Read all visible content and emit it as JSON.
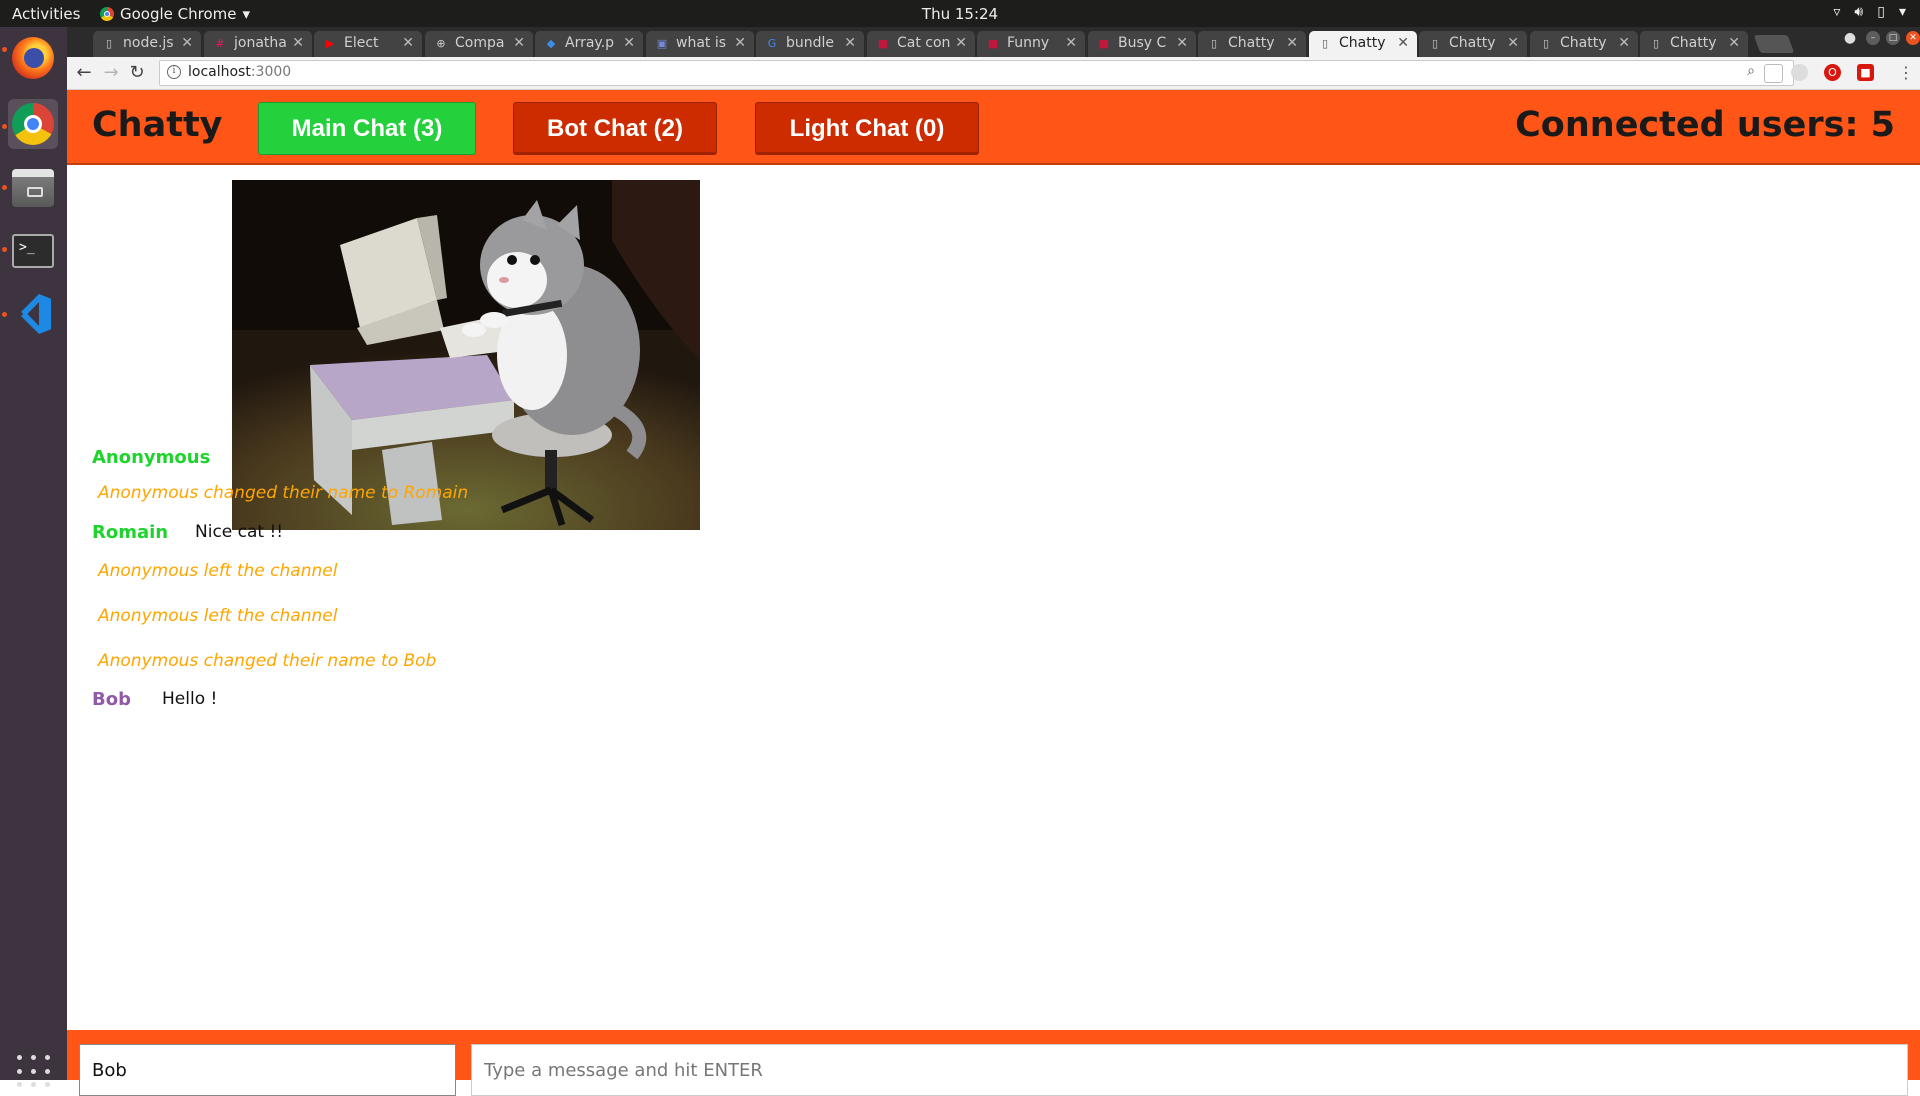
{
  "os": {
    "activities": "Activities",
    "app_menu": "Google Chrome",
    "clock": "Thu 15:24"
  },
  "browser": {
    "tabs": [
      {
        "title": "node.js",
        "favicon": "page-icon"
      },
      {
        "title": "jonatha",
        "favicon": "slack-icon"
      },
      {
        "title": "Elect",
        "favicon": "youtube-icon"
      },
      {
        "title": "Compa",
        "favicon": "globe-icon"
      },
      {
        "title": "Array.p",
        "favicon": "mdn-icon"
      },
      {
        "title": "what is",
        "favicon": "discord-icon"
      },
      {
        "title": "bundle",
        "favicon": "google-icon"
      },
      {
        "title": "Cat con",
        "favicon": "site-icon"
      },
      {
        "title": "Funny",
        "favicon": "site-icon"
      },
      {
        "title": "Busy C",
        "favicon": "site-icon"
      },
      {
        "title": "Chatty",
        "favicon": "page-icon"
      },
      {
        "title": "Chatty",
        "favicon": "page-icon",
        "active": true
      },
      {
        "title": "Chatty",
        "favicon": "page-icon"
      },
      {
        "title": "Chatty",
        "favicon": "page-icon"
      },
      {
        "title": "Chatty",
        "favicon": "page-icon"
      }
    ],
    "url_host": "localhost",
    "url_port": ":3000"
  },
  "app": {
    "brand": "Chatty",
    "channels": [
      {
        "label": "Main Chat (3)",
        "status": "active",
        "color": "#25d03d"
      },
      {
        "label": "Bot Chat (2)",
        "status": "inactive",
        "color": "#cc2c00"
      },
      {
        "label": "Light Chat (0)",
        "status": "inactive",
        "color": "#cc2c00"
      }
    ],
    "connected_users": "Connected users: 5",
    "header_color": "#ff5617"
  },
  "messages": [
    {
      "type": "image",
      "user": "Anonymous",
      "user_color": "#1ed42c",
      "image": "cat-at-computer"
    },
    {
      "type": "notification",
      "text": "Anonymous changed their name to Romain"
    },
    {
      "type": "message",
      "user": "Romain",
      "user_color": "#1ed42c",
      "content": "Nice cat !!"
    },
    {
      "type": "notification",
      "text": "Anonymous left the channel"
    },
    {
      "type": "notification",
      "text": "Anonymous left the channel"
    },
    {
      "type": "notification",
      "text": "Anonymous changed their name to Bob"
    },
    {
      "type": "message",
      "user": "Bob",
      "user_color": "#9159a7",
      "content": "Hello !"
    }
  ],
  "footer": {
    "username_value": "Bob",
    "message_placeholder": "Type a message and hit ENTER"
  }
}
